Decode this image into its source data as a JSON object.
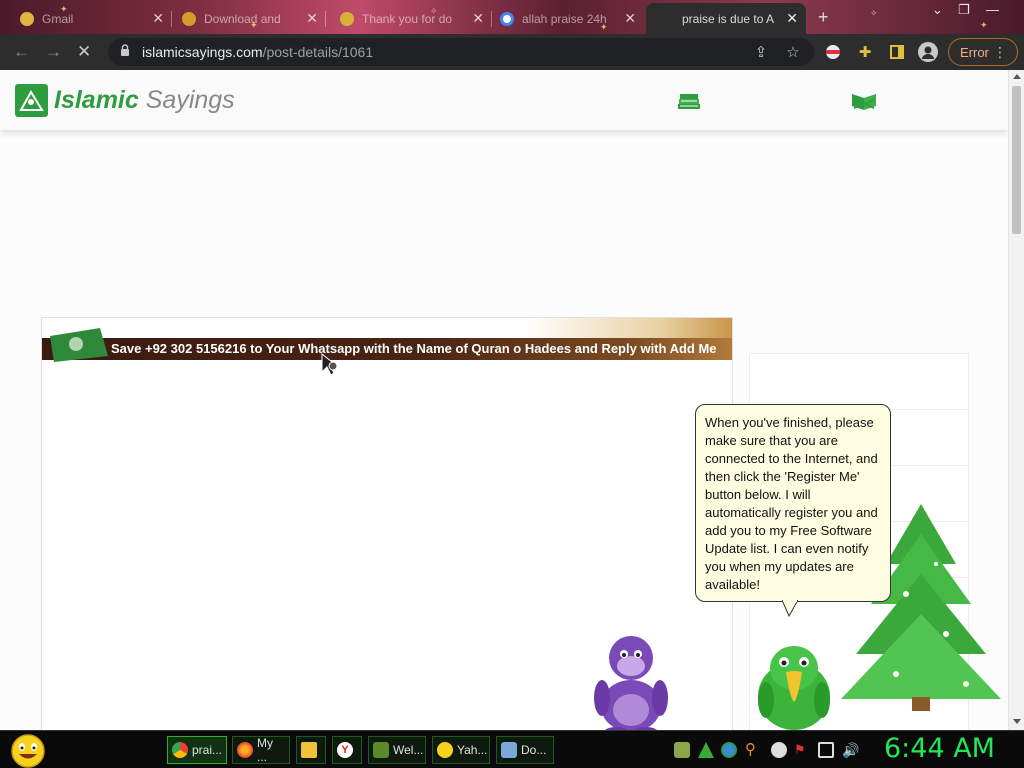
{
  "browser": {
    "tabs": [
      {
        "title": "Gmail",
        "favicon_color": "#e3b341"
      },
      {
        "title": "Download and",
        "favicon_color": "#d59b2b"
      },
      {
        "title": "Thank you for do",
        "favicon_color": "#d8b33a"
      },
      {
        "title": "allah praise 24h",
        "favicon_color": "#4285f4"
      },
      {
        "title": "praise is due to A",
        "favicon_color": "#2d2d2d",
        "active": true
      }
    ],
    "new_tab_label": "+",
    "url_host": "islamicsayings.com",
    "url_path": "/post-details/1061",
    "error_label": "Error"
  },
  "site": {
    "logo_part1": "Islamic",
    "logo_part2": "Sayings",
    "banner_text": "Save +92 302 5156216 to Your Whatsapp with the Name of Quran o Hadees and Reply with Add Me",
    "brand_color": "#2e9d3f"
  },
  "assistant": {
    "bubble_text": "When you've finished, please make sure that you are connected to the Internet, and then click the 'Register Me' button below. I will automatically register you and add you to my Free Software Update list. I can even notify you when my updates are available!"
  },
  "taskbar": {
    "tasks": [
      {
        "label": "prai...",
        "icon": "chrome-icon",
        "active": true
      },
      {
        "label": "My ...",
        "icon": "firefox-icon"
      },
      {
        "label": "",
        "icon": "folder-icon"
      },
      {
        "label": "",
        "icon": "yandex-icon"
      },
      {
        "label": "Wel...",
        "icon": "bonzi-icon"
      },
      {
        "label": "Yah...",
        "icon": "yahoo-messenger-icon"
      },
      {
        "label": "Do...",
        "icon": "download-icon"
      }
    ],
    "clock": "6:44 AM"
  }
}
